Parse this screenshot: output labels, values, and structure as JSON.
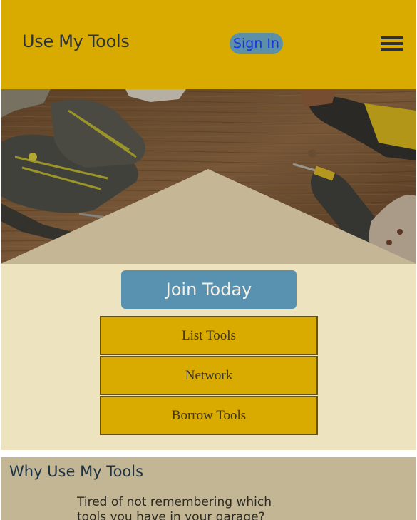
{
  "header": {
    "brand": "Use My Tools",
    "sign_in_label": "Sign In",
    "menu_icon": "hamburger-menu-icon"
  },
  "hero": {
    "image": "workbench-tools-photo"
  },
  "actions": {
    "join_label": "Join Today",
    "items": [
      {
        "label": "List Tools"
      },
      {
        "label": "Network"
      },
      {
        "label": "Borrow Tools"
      }
    ]
  },
  "why": {
    "title": "Why Use My Tools",
    "body": "Tired of not remembering which tools you have in your garage?"
  },
  "colors": {
    "header_bg": "#d9ab00",
    "panel_bg": "#ede4bf",
    "why_bg": "#c2b694",
    "join_bg": "#5892b0",
    "signin_bg": "#5d8fa6"
  }
}
